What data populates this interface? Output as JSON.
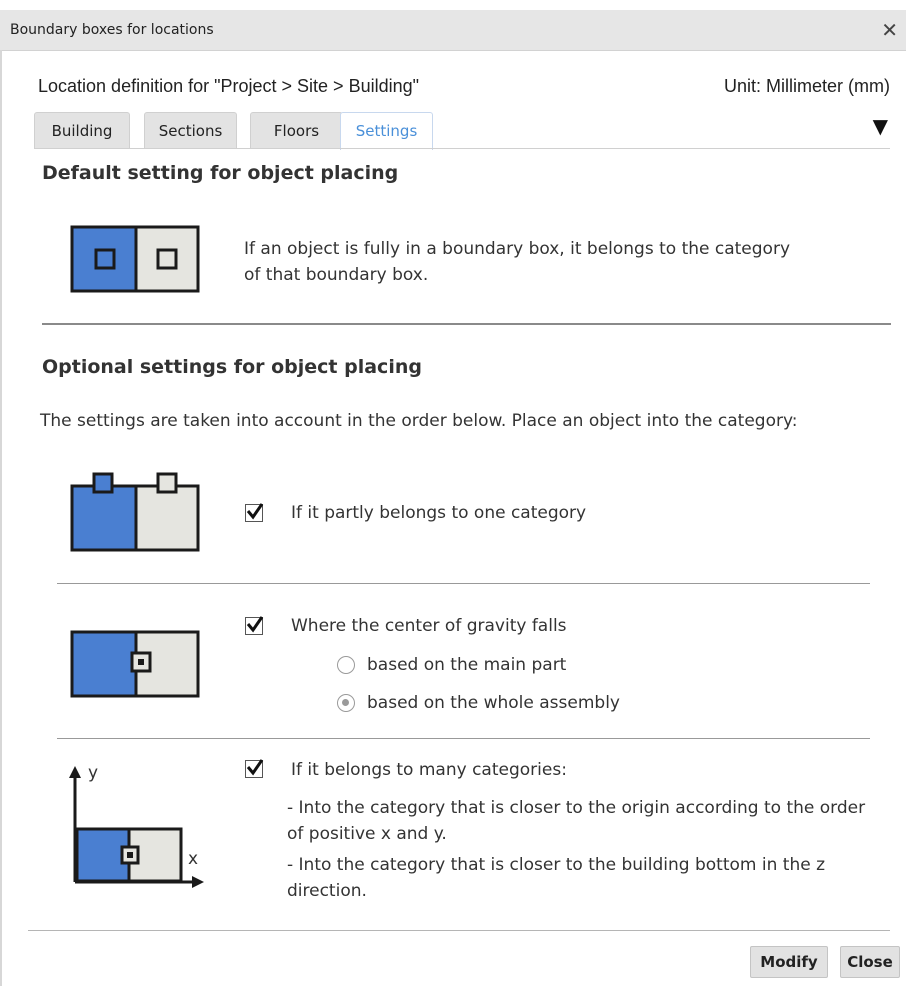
{
  "window": {
    "title": "Boundary boxes for locations",
    "close_glyph": "✕"
  },
  "header": {
    "location_definition": "Location definition for \"Project > Site > Building\"",
    "unit": "Unit: Millimeter (mm)"
  },
  "tabs": [
    {
      "label": "Building",
      "active": false
    },
    {
      "label": "Sections",
      "active": false
    },
    {
      "label": "Floors",
      "active": false
    },
    {
      "label": "Settings",
      "active": true
    }
  ],
  "dropdown_glyph": "▼",
  "default_section": {
    "heading": "Default setting for object placing",
    "description": "If an object is fully in a boundary box, it belongs to the category of that boundary box."
  },
  "optional_section": {
    "heading": "Optional settings for object placing",
    "intro": "The settings are taken into account in the order below. Place an object into the category:"
  },
  "options": [
    {
      "label": "If it partly belongs to one category",
      "checked": true
    },
    {
      "label": "Where the center of gravity falls",
      "checked": true,
      "radios": [
        {
          "label": "based on the main part",
          "selected": false
        },
        {
          "label": "based on the whole assembly",
          "selected": true
        }
      ]
    },
    {
      "label": "If it belongs to many categories:",
      "checked": true,
      "detail_lines": [
        "- Into the category that is closer to the origin according to the order of positive x and y.",
        "- Into the category that is closer to the building bottom in the z direction."
      ],
      "axis_labels": {
        "y": "y",
        "x": "x"
      }
    }
  ],
  "buttons": {
    "modify": "Modify",
    "close": "Close"
  },
  "colors": {
    "accent_blue": "#4a7fd1",
    "light_box": "#e5e5e0",
    "tab_active_text": "#4a90d9"
  }
}
